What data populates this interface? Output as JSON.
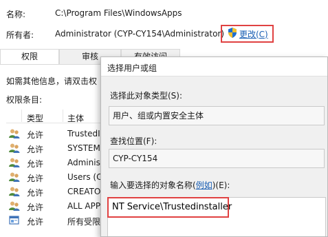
{
  "header": {
    "name_label": "名称:",
    "name_value": "C:\\Program Files\\WindowsApps",
    "owner_label": "所有者:",
    "owner_value": "Administrator (CYP-CY154\\Administrator)",
    "change_link": "更改(C)"
  },
  "tabs": [
    {
      "label": "权限"
    },
    {
      "label": "审核"
    },
    {
      "label": "有效访问"
    }
  ],
  "info_text": "如需其他信息，请双击权",
  "entries_label": "权限条目:",
  "columns": {
    "type": "类型",
    "principal": "主体"
  },
  "rows": [
    {
      "type": "允许",
      "principal": "TrustedI",
      "icon": "users-icon"
    },
    {
      "type": "允许",
      "principal": "SYSTEM",
      "icon": "users-icon"
    },
    {
      "type": "允许",
      "principal": "Administ",
      "icon": "users-icon"
    },
    {
      "type": "允许",
      "principal": "Users (C",
      "icon": "users-icon"
    },
    {
      "type": "允许",
      "principal": "CREATO",
      "icon": "users-icon"
    },
    {
      "type": "允许",
      "principal": "ALL APPI",
      "icon": "users-icon"
    },
    {
      "type": "允许",
      "principal": "所有受限",
      "icon": "app-icon"
    }
  ],
  "dialog": {
    "title": "选择用户或组",
    "object_type_label": "选择此对象类型(S):",
    "object_type_value": "用户、组或内置安全主体",
    "location_label": "查找位置(F):",
    "location_value": "CYP-CY154",
    "names_label_prefix": "输入要选择的对象名称(",
    "names_label_link": "例如",
    "names_label_suffix": ")(E):",
    "names_value": "NT Service\\Trustedinstaller"
  },
  "colors": {
    "highlight": "#e04141",
    "link": "#1a5fb4",
    "dialog_bg": "#f0f0f0"
  }
}
